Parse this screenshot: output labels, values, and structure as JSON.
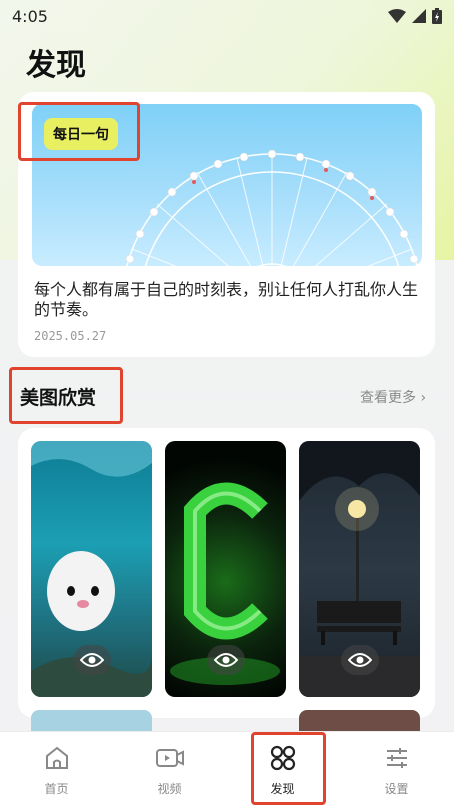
{
  "status": {
    "time": "4:05"
  },
  "page": {
    "title": "发现"
  },
  "daily": {
    "tag": "每日一句",
    "quote": "每个人都有属于自己的时刻表，别让任何人打乱你人生的节奏。",
    "date": "2025.05.27"
  },
  "gallery": {
    "title": "美图欣赏",
    "more": "查看更多 ›",
    "photos": [
      "photo-otter",
      "photo-neon-c",
      "photo-park-bench"
    ]
  },
  "nav": {
    "items": [
      {
        "label": "首页",
        "icon": "home-icon"
      },
      {
        "label": "视频",
        "icon": "video-icon"
      },
      {
        "label": "发现",
        "icon": "discover-grid-icon",
        "active": true
      },
      {
        "label": "设置",
        "icon": "settings-sliders-icon"
      }
    ]
  },
  "colors": {
    "highlight": "#e0442e",
    "tag_bg": "#e8f062"
  }
}
